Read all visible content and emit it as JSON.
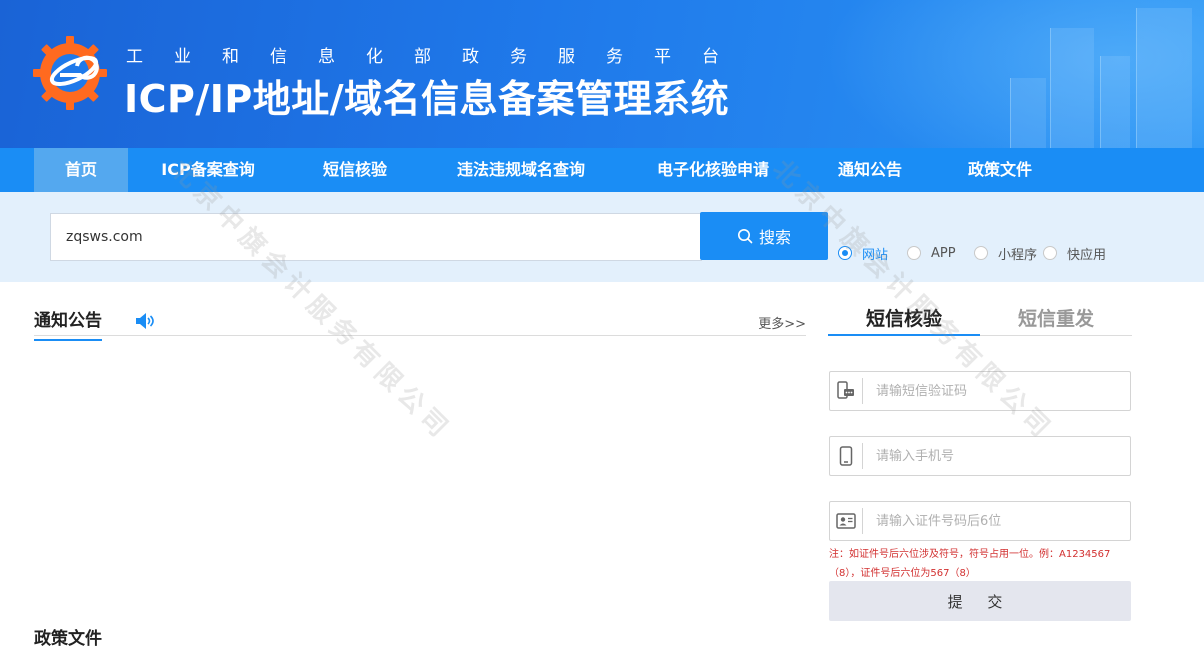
{
  "header": {
    "subtitle": "工业和信息化部政务服务平台",
    "title": "ICP/IP地址/域名信息备案管理系统"
  },
  "nav": {
    "items": [
      {
        "label": "首页",
        "active": true
      },
      {
        "label": "ICP备案查询"
      },
      {
        "label": "短信核验"
      },
      {
        "label": "违法违规域名查询"
      },
      {
        "label": "电子化核验申请"
      },
      {
        "label": "通知公告"
      },
      {
        "label": "政策文件"
      }
    ]
  },
  "search": {
    "value": "zqsws.com",
    "button_label": "搜索",
    "options": [
      {
        "label": "网站",
        "checked": true
      },
      {
        "label": "APP"
      },
      {
        "label": "小程序"
      },
      {
        "label": "快应用"
      }
    ]
  },
  "notice": {
    "title": "通知公告",
    "more": "更多>>"
  },
  "policy": {
    "title": "政策文件"
  },
  "sms": {
    "tabs": [
      {
        "label": "短信核验",
        "active": true
      },
      {
        "label": "短信重发"
      }
    ],
    "code_placeholder": "请输短信验证码",
    "phone_placeholder": "请输入手机号",
    "id_placeholder": "请输入证件号码后6位",
    "note": "注：如证件号后六位涉及符号，符号占用一位。例：A1234567（8），证件号后六位为567（8）",
    "submit": "提 交"
  },
  "watermark": "北京中旗会计服务有限公司",
  "colors": {
    "primary": "#1a8df5",
    "header_dark": "#1a63d6",
    "nav_active": "#54a8ef",
    "note_red": "#d23030"
  }
}
